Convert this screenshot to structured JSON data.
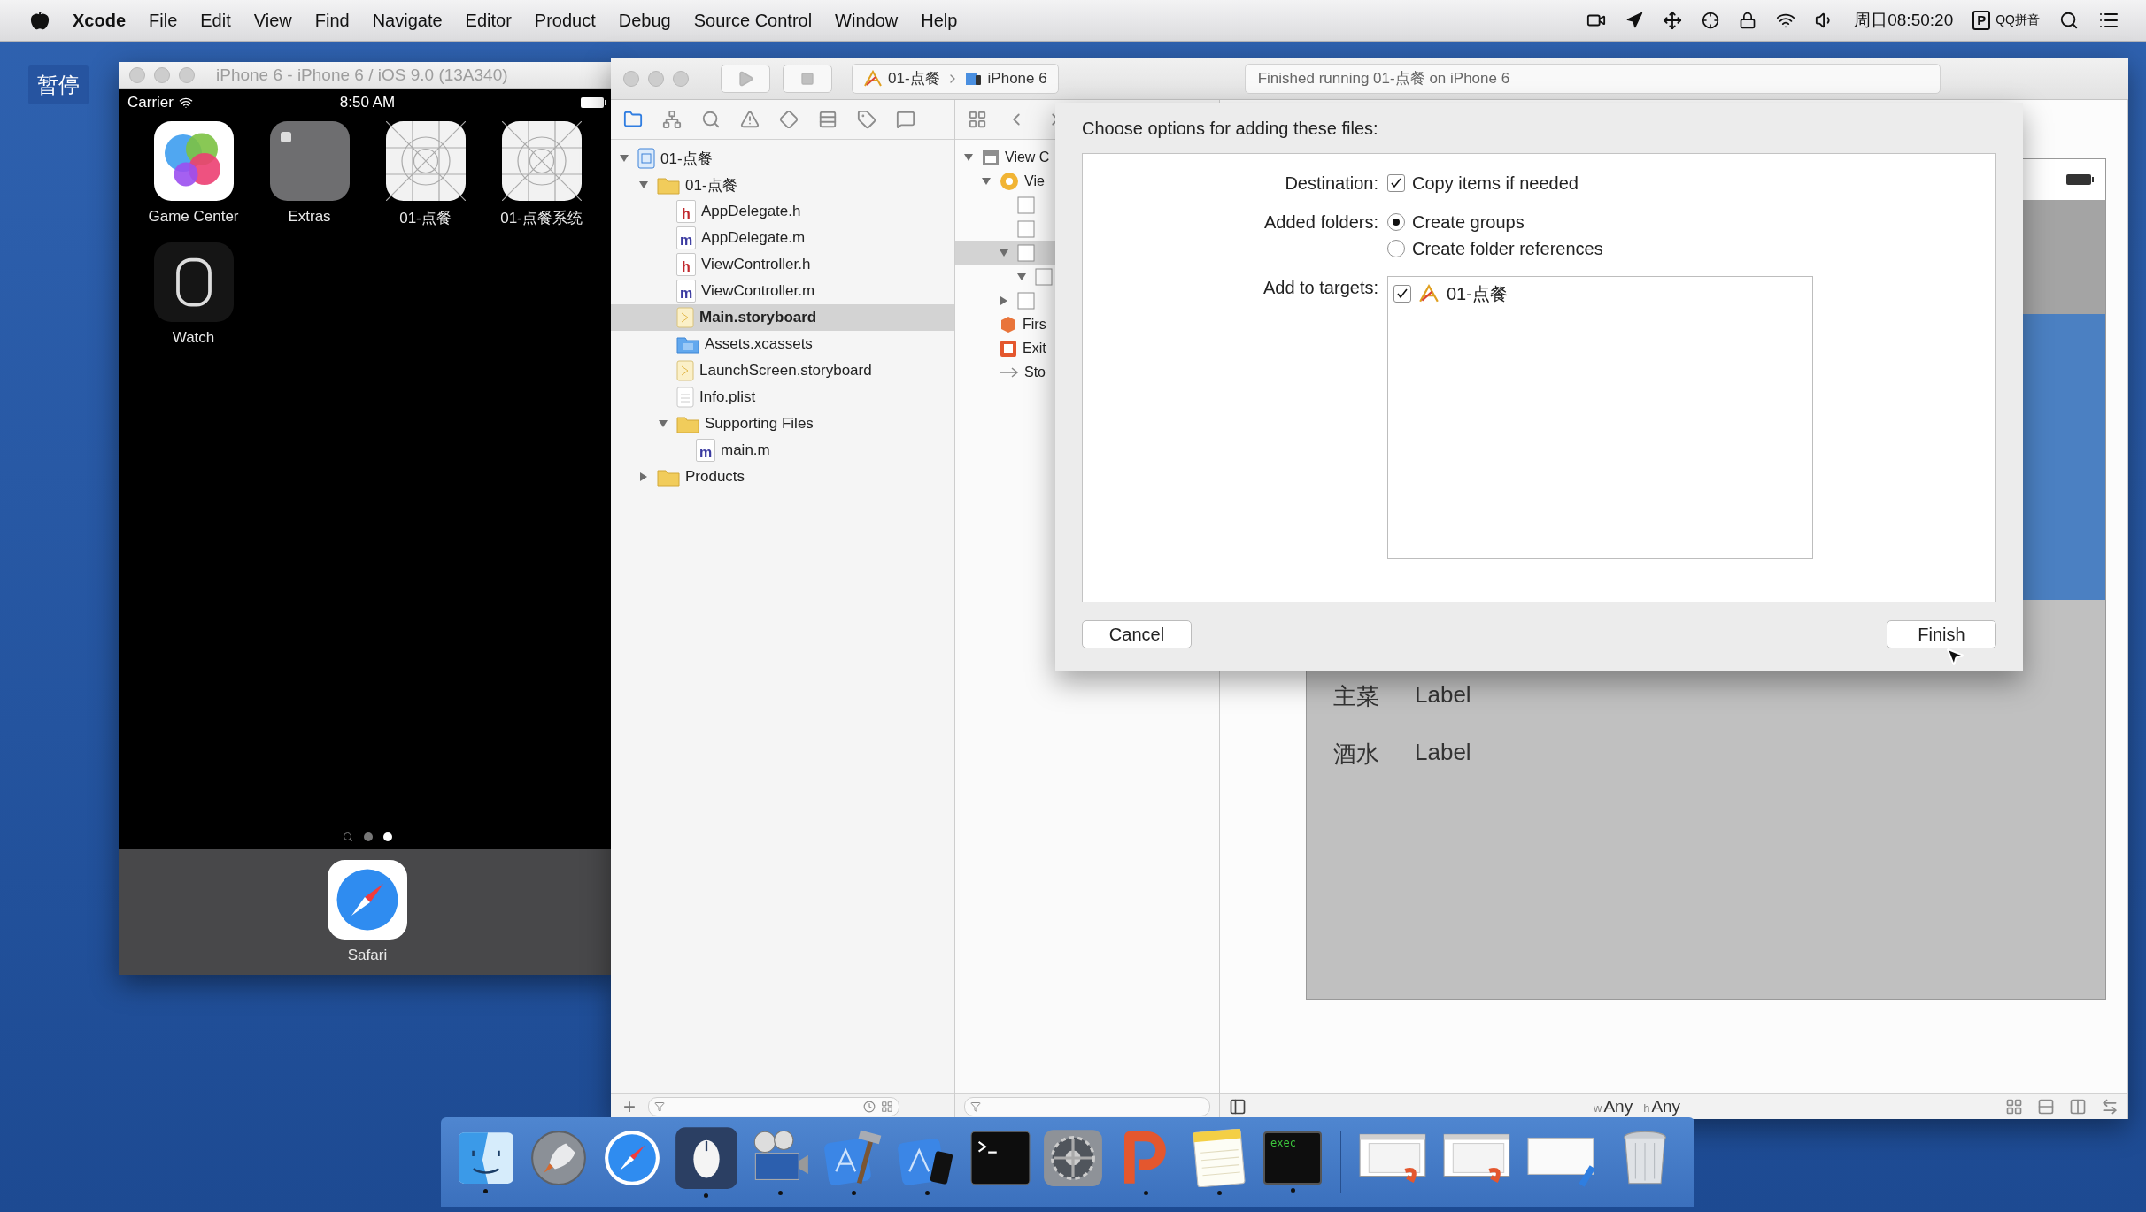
{
  "pause_badge": "暂停",
  "menu_bar": {
    "app": "Xcode",
    "items": [
      "File",
      "Edit",
      "View",
      "Find",
      "Navigate",
      "Editor",
      "Product",
      "Debug",
      "Source Control",
      "Window",
      "Help"
    ],
    "clock": "周日08:50:20",
    "input_badge": "P",
    "input_method": "QQ拼音"
  },
  "simulator": {
    "title": "iPhone 6 - iPhone 6 / iOS 9.0 (13A340)",
    "carrier": "Carrier",
    "time": "8:50 AM",
    "apps": [
      {
        "label": "Game Center",
        "kind": "game-center"
      },
      {
        "label": "Extras",
        "kind": "folder"
      },
      {
        "label": "01-点餐",
        "kind": "placeholder"
      },
      {
        "label": "01-点餐系统",
        "kind": "placeholder"
      },
      {
        "label": "Watch",
        "kind": "watch"
      }
    ],
    "pages": [
      {
        "kind": "search",
        "selected": false
      },
      {
        "kind": "dot",
        "selected": false
      },
      {
        "kind": "dot",
        "selected": true
      }
    ],
    "dock_apps": [
      {
        "label": "Safari",
        "kind": "safari"
      }
    ]
  },
  "xcode": {
    "toolbar": {
      "scheme": "01-点餐",
      "device": "iPhone 6",
      "status": "Finished running 01-点餐 on iPhone 6"
    },
    "navigator_tabs": [
      {
        "selected": true
      },
      {
        "selected": false
      },
      {
        "selected": false
      },
      {
        "selected": false
      },
      {
        "selected": false
      },
      {
        "selected": false
      },
      {
        "selected": false
      },
      {
        "selected": false
      }
    ],
    "files": [
      {
        "name": "01-点餐",
        "kind": "project",
        "expanded": true,
        "selected": false,
        "children": [
          {
            "name": "01-点餐",
            "kind": "group",
            "expanded": true,
            "selected": false,
            "children": [
              {
                "name": "AppDelegate.h",
                "kind": "header",
                "badge": "h",
                "selected": false
              },
              {
                "name": "AppDelegate.m",
                "kind": "source",
                "badge": "m",
                "selected": false
              },
              {
                "name": "ViewController.h",
                "kind": "header",
                "badge": "h",
                "selected": false
              },
              {
                "name": "ViewController.m",
                "kind": "source",
                "badge": "m",
                "selected": false
              },
              {
                "name": "Main.storyboard",
                "kind": "storyboard",
                "selected": true
              },
              {
                "name": "Assets.xcassets",
                "kind": "assets",
                "selected": false
              },
              {
                "name": "LaunchScreen.storyboard",
                "kind": "storyboard",
                "selected": false
              },
              {
                "name": "Info.plist",
                "kind": "plist",
                "selected": false
              },
              {
                "name": "Supporting Files",
                "kind": "group",
                "expanded": true,
                "selected": false,
                "children": [
                  {
                    "name": "main.m",
                    "kind": "source",
                    "badge": "m",
                    "selected": false
                  }
                ]
              }
            ]
          },
          {
            "name": "Products",
            "kind": "group",
            "expanded": false,
            "selected": false
          }
        ]
      }
    ],
    "navigator_footer": {
      "add": "+"
    },
    "outline": [
      {
        "name": "View C",
        "kind": "scene",
        "expanded": true,
        "selected": false,
        "children": [
          {
            "name": "Vie",
            "kind": "view-controller",
            "expanded": true,
            "selected": false,
            "children": [
              {
                "kind": "view",
                "selected": false
              },
              {
                "kind": "view",
                "selected": false
              },
              {
                "kind": "view",
                "expanded": true,
                "selected": true,
                "children": [
                  {
                    "kind": "view",
                    "expanded": true,
                    "selected": false
                  }
                ]
              },
              {
                "kind": "view",
                "expanded": false,
                "selected": false
              }
            ]
          },
          {
            "name": "Firs",
            "kind": "first-responder",
            "selected": false
          },
          {
            "name": "Exit",
            "kind": "exit",
            "selected": false
          },
          {
            "name": "Sto",
            "kind": "segue",
            "selected": false
          }
        ]
      }
    ],
    "canvas": {
      "rows": [
        {
          "title": "主菜",
          "value": "Label"
        },
        {
          "title": "酒水",
          "value": "Label"
        }
      ],
      "size_class": [
        {
          "axis": "w",
          "value": "Any"
        },
        {
          "axis": "h",
          "value": "Any"
        }
      ]
    },
    "dialog": {
      "title": "Choose options for adding these files:",
      "destination": {
        "label": "Destination:",
        "text": "Copy items if needed",
        "checked": true
      },
      "added_folders": {
        "label": "Added folders:",
        "options": [
          {
            "text": "Create groups",
            "selected": true
          },
          {
            "text": "Create folder references",
            "selected": false
          }
        ]
      },
      "targets": {
        "label": "Add to targets:",
        "items": [
          {
            "name": "01-点餐",
            "checked": true
          }
        ]
      },
      "buttons": [
        {
          "label": "Cancel"
        },
        {
          "label": "Finish"
        }
      ]
    }
  },
  "dock": {
    "apps": [
      {
        "kind": "finder",
        "running": true
      },
      {
        "kind": "rocket",
        "running": false
      },
      {
        "kind": "safari",
        "running": false
      },
      {
        "kind": "mouse",
        "running": true
      },
      {
        "kind": "film",
        "running": true
      },
      {
        "kind": "xcode",
        "running": true
      },
      {
        "kind": "simulator",
        "running": true
      },
      {
        "kind": "terminal",
        "running": false
      },
      {
        "kind": "gear",
        "running": false
      },
      {
        "kind": "p-app",
        "running": true
      },
      {
        "kind": "notes",
        "running": true
      },
      {
        "kind": "console",
        "caption": "exec",
        "running": true
      }
    ],
    "documents": [
      {
        "kind": "presentation"
      },
      {
        "kind": "presentation"
      },
      {
        "kind": "xcode-window"
      },
      {
        "kind": "trash"
      }
    ]
  }
}
